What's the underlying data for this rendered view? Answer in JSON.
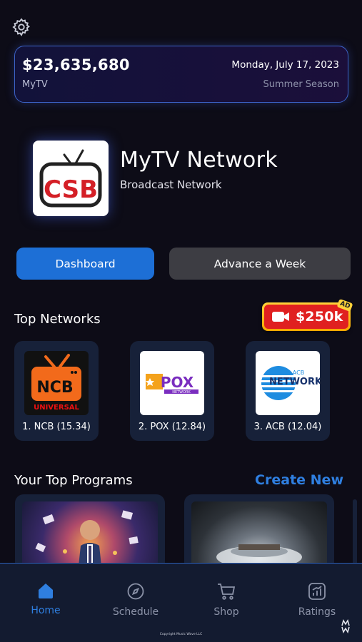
{
  "header": {
    "balance": "$23,635,680",
    "company": "MyTV",
    "date": "Monday, July 17, 2023",
    "season": "Summer Season"
  },
  "network": {
    "logo_text": "CSB",
    "name": "MyTV Network",
    "subtitle": "Broadcast Network"
  },
  "actions": {
    "dashboard": "Dashboard",
    "advance": "Advance a Week"
  },
  "top_networks": {
    "title": "Top Networks",
    "ad": {
      "amount": "$250k",
      "tag": "AD"
    },
    "items": [
      {
        "label": "1. NCB (15.34)",
        "logo": "NCB",
        "logo_sub": "UNIVERSAL"
      },
      {
        "label": "2. POX (12.84)",
        "logo": "POX",
        "logo_sub": "NETWORK"
      },
      {
        "label": "3. ACB (12.04)",
        "logo": "NETWORK",
        "logo_sub": "ACB"
      }
    ]
  },
  "programs": {
    "title": "Your Top Programs",
    "create_new": "Create New"
  },
  "nav": {
    "items": [
      {
        "label": "Home",
        "icon": "home-icon",
        "active": true
      },
      {
        "label": "Schedule",
        "icon": "compass-icon"
      },
      {
        "label": "Shop",
        "icon": "cart-icon"
      },
      {
        "label": "Ratings",
        "icon": "chart-icon"
      }
    ],
    "copyright": "Copyright Music Wave LLC"
  },
  "colors": {
    "background": "#0d0c17",
    "accent": "#1d6fd6",
    "link": "#2f7fe0",
    "card": "#172139",
    "ad_red": "#e02020",
    "ad_gold": "#ffd23a"
  }
}
